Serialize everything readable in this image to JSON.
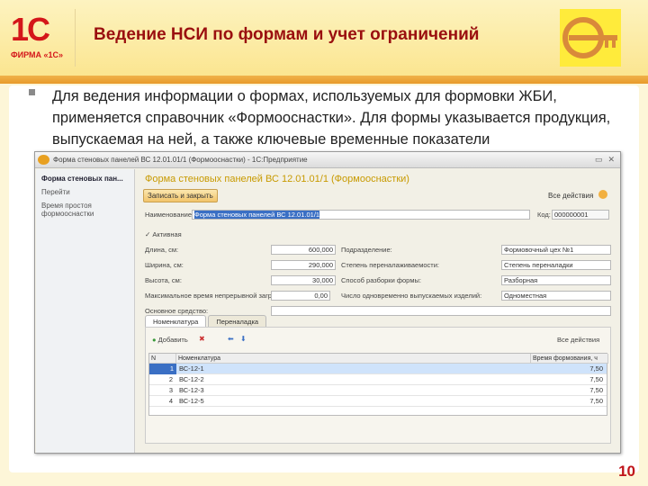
{
  "header": {
    "title": "Ведение НСИ по формам и учет ограничений",
    "logo_1c": "1С",
    "logo_1c_sub": "ФИРМА «1С»"
  },
  "bullet_text": "Для ведения информации о формах, используемых для формовки ЖБИ, применяется справочник «Формооснастки». Для формы указывается продукция, выпускаемая на ней, а также ключевые временные показатели",
  "page_number": "10",
  "window": {
    "titlebar": "Форма стеновых панелей ВС 12.01.01/1 (Формооснастки) - 1С:Предприятие",
    "side": [
      "Форма стеновых пан...",
      "Перейти",
      "Время простоя формооснастки"
    ],
    "form_title": "Форма стеновых панелей ВС 12.01.01/1 (Формооснастки)",
    "save_close": "Записать и закрыть",
    "all_actions": "Все действия",
    "name_label": "Наименование:",
    "name_value": "Форма стеновых панелей ВС 12.01.01/1",
    "code_label": "Код:",
    "code_value": "000000001",
    "active": "Активная",
    "left_fields": [
      {
        "label": "Длина, см:",
        "value": "600,000"
      },
      {
        "label": "Ширина, см:",
        "value": "290,000"
      },
      {
        "label": "Высота, см:",
        "value": "30,000"
      },
      {
        "label": "Максимальное время непрерывной загрузки, ч:",
        "value": "0,00"
      },
      {
        "label": "Основное средство:",
        "value": ""
      }
    ],
    "right_fields": [
      {
        "label": "Подразделение:",
        "value": "Формовочный цех №1"
      },
      {
        "label": "Степень переналаживаемости:",
        "value": "Степень переналадки"
      },
      {
        "label": "Способ разборки формы:",
        "value": "Разборная"
      },
      {
        "label": "Число одновременно выпускаемых изделий:",
        "value": "Одноместная"
      }
    ],
    "tabs": [
      "Номенклатура",
      "Переналадка"
    ],
    "add_button": "Добавить",
    "all_actions2": "Все действия",
    "columns": [
      "N",
      "Номенклатура",
      "Время формования, ч"
    ],
    "rows": [
      {
        "n": "1",
        "name": "ВС-12-1",
        "time": "7,50"
      },
      {
        "n": "2",
        "name": "ВС-12-2",
        "time": "7,50"
      },
      {
        "n": "3",
        "name": "ВС-12-3",
        "time": "7,50"
      },
      {
        "n": "4",
        "name": "ВС-12-5",
        "time": "7,50"
      }
    ]
  }
}
